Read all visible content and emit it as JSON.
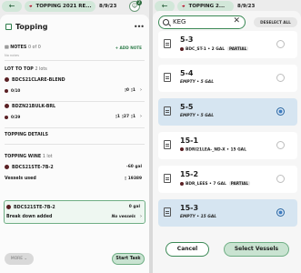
{
  "left": {
    "topbar": {
      "back": "←",
      "title_icon": "wine-glass-icon",
      "title": "TOPPING 2021 RE...",
      "date": "8/9/23",
      "badge": "2"
    },
    "header": {
      "title": "Topping",
      "menu": "•••"
    },
    "notes": {
      "label": "NOTES",
      "count": "0 of 0",
      "sub": "No notes",
      "add": "+ ADD NOTE"
    },
    "lot_to_top": {
      "label": "LOT TO TOP",
      "count": "2 lots"
    },
    "lots": [
      {
        "name": "BDCS21CLARE-BLEND",
        "qty": "0/10",
        "right": "▯0 ▯1"
      },
      {
        "name": "BDZN21BULK-BRL",
        "qty": "0/29",
        "right": "▯1 ▯27 ▯1"
      }
    ],
    "details": {
      "label": "TOPPING DETAILS"
    },
    "wine": {
      "label": "TOPPING WINE",
      "count": "1 lot"
    },
    "wine_lot": {
      "name": "BDCS21STE-7B-2",
      "amount": "-60 gal"
    },
    "vessels_used": {
      "label": "Vessels used",
      "value": "19389"
    },
    "selected_lot": {
      "name": "BDCS21STE-7B-2",
      "amount": "0 gal"
    },
    "breakdown": {
      "label": "Break down added",
      "value": "No vessels"
    },
    "more": "MORE",
    "start": "Start Task"
  },
  "right": {
    "topbar": {
      "back": "←",
      "title": "TOPPING 2...",
      "date": "8/9/23"
    },
    "search": {
      "value": "KEG"
    },
    "deselect": "DESELECT ALL",
    "vessels": [
      {
        "name": "5-3",
        "line": "BDC_ST-1 • 2 GAL",
        "tag": "PARTIAL",
        "empty": false,
        "selected": false
      },
      {
        "name": "5-4",
        "line": "EMPTY • 5 GAL",
        "tag": "",
        "empty": true,
        "selected": false
      },
      {
        "name": "5-5",
        "line": "EMPTY • 5 GAL",
        "tag": "",
        "empty": true,
        "selected": true
      },
      {
        "name": "15-1",
        "line": "BDRI21LEA-_ND-X • 15 GAL",
        "tag": "",
        "empty": false,
        "selected": false
      },
      {
        "name": "15-2",
        "line": "BDR_LEES • 7 GAL",
        "tag": "PARTIAL",
        "empty": false,
        "selected": false
      },
      {
        "name": "15-3",
        "line": "EMPTY • 15 GAL",
        "tag": "",
        "empty": true,
        "selected": true
      }
    ],
    "cancel": "Cancel",
    "select": "Select Vessels"
  },
  "colors": {
    "accent": "#3c8a56",
    "wine_dot": "#5a2024",
    "selected_row": "#d6e5f1",
    "radio_on": "#3f7dc1"
  }
}
